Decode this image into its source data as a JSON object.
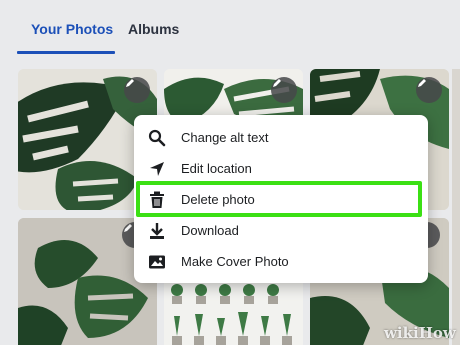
{
  "tabs": [
    {
      "label": "Your Photos",
      "active": true
    },
    {
      "label": "Albums",
      "active": false
    }
  ],
  "colors": {
    "accent": "#1c50b8",
    "highlight": "#3be014",
    "menu_bg": "#ffffff",
    "page_bg": "#e9eaec"
  },
  "context_menu": {
    "items": [
      {
        "label": "Change alt text",
        "icon": "search-icon"
      },
      {
        "label": "Edit location",
        "icon": "location-arrow-icon"
      },
      {
        "label": "Delete photo",
        "icon": "trash-icon",
        "highlighted": true
      },
      {
        "label": "Download",
        "icon": "download-icon"
      },
      {
        "label": "Make Cover Photo",
        "icon": "image-icon"
      }
    ]
  },
  "photos": [
    {
      "alt": "monstera leaves",
      "edit_icon": "pencil-icon"
    },
    {
      "alt": "monstera plant",
      "edit_icon": "pencil-icon"
    },
    {
      "alt": "monstera close up",
      "edit_icon": "pencil-icon"
    },
    {
      "alt": "monstera on wall",
      "edit_icon": "pencil-icon"
    },
    {
      "alt": "potted plants shelves"
    },
    {
      "alt": "monstera pot",
      "edit_icon": "pencil-icon"
    }
  ],
  "watermark": "wikiHow"
}
